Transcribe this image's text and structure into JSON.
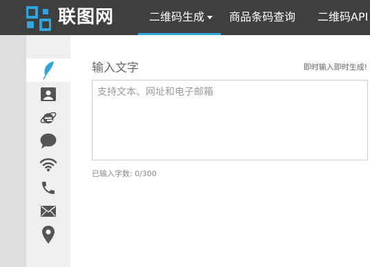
{
  "header": {
    "brand": "联图网",
    "nav": [
      {
        "label": "二维码生成"
      },
      {
        "label": "商品条码查询"
      },
      {
        "label": "二维码API"
      }
    ]
  },
  "sidebar": {
    "items": [
      {
        "icon": "feather-icon",
        "color": "#2ea7e0",
        "active": true
      },
      {
        "icon": "contact-card-icon"
      },
      {
        "icon": "browser-e-icon"
      },
      {
        "icon": "chat-bubble-icon"
      },
      {
        "icon": "wifi-icon"
      },
      {
        "icon": "phone-icon"
      },
      {
        "icon": "envelope-icon"
      },
      {
        "icon": "location-pin-icon"
      }
    ]
  },
  "main": {
    "heading": "输入文字",
    "hint": "即时输入即时生成!",
    "textarea_placeholder": "支持文本、网址和电子邮箱",
    "counter": "已输入字数: 0/300"
  },
  "colors": {
    "topbar": "#3f3f3f",
    "accent": "#2ea7e0",
    "icon": "#555555"
  }
}
